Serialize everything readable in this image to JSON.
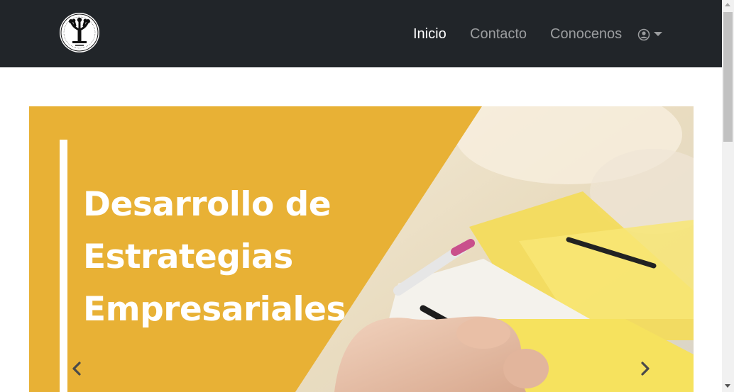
{
  "navbar": {
    "logo_icon": "tree-logo-icon",
    "links": [
      {
        "label": "Inicio",
        "active": true
      },
      {
        "label": "Contacto",
        "active": false
      },
      {
        "label": "Conocenos",
        "active": false
      }
    ],
    "user_icon": "user-circle-icon",
    "dropdown_icon": "caret-down-icon"
  },
  "carousel": {
    "slide": {
      "title_lines": [
        "Desarrollo de",
        "Estrategias",
        "Empresariales"
      ]
    },
    "prev_icon": "chevron-left-icon",
    "next_icon": "chevron-right-icon"
  },
  "colors": {
    "navbar_bg": "#212529",
    "slide_accent": "#e8b135",
    "nav_active": "#ffffff",
    "nav_inactive": "#9a9da0"
  }
}
